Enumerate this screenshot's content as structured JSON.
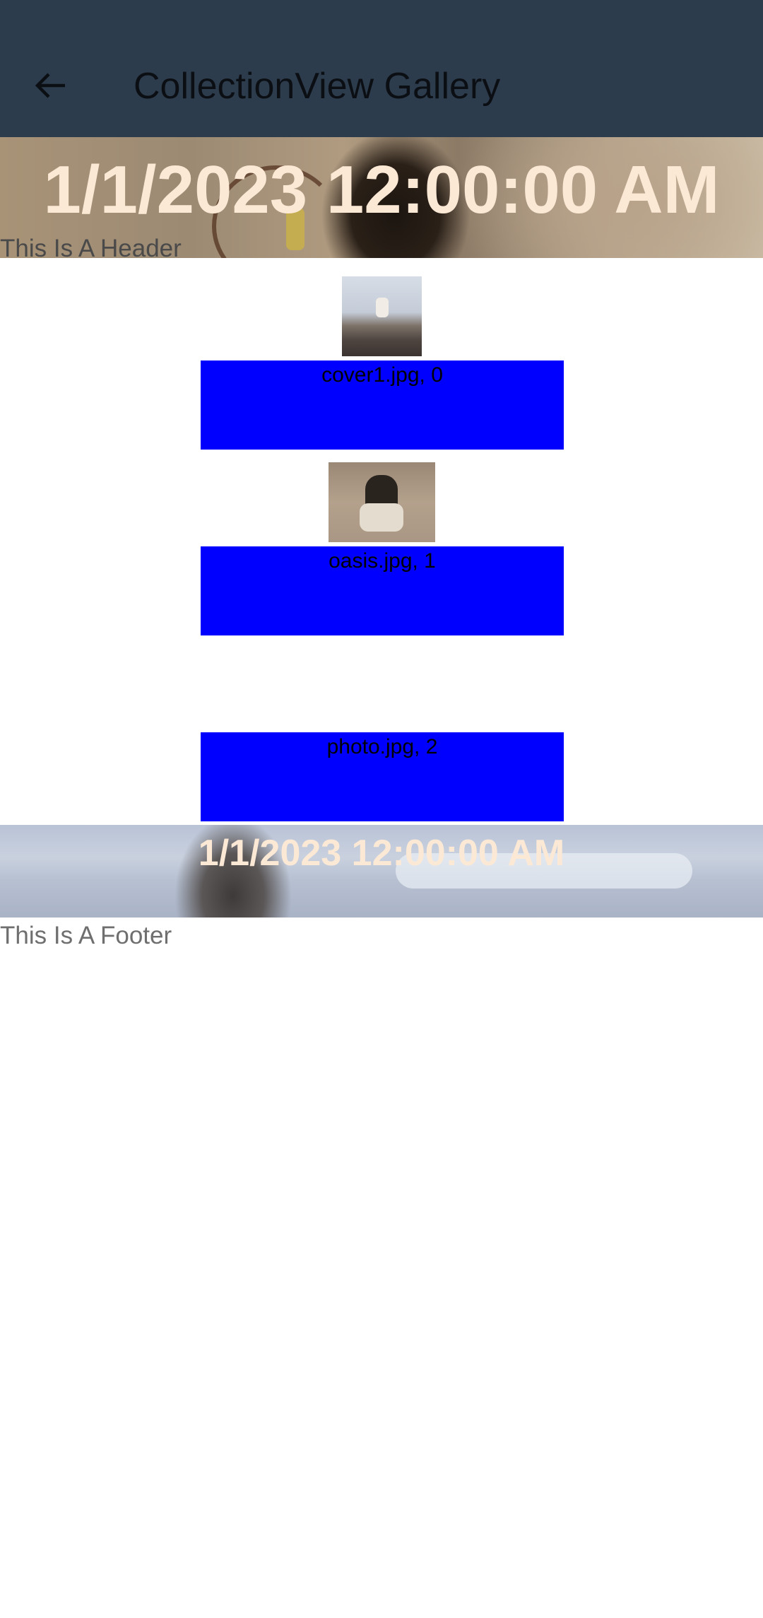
{
  "app_bar": {
    "title": "CollectionView Gallery",
    "back_icon": "arrow-left-icon",
    "background": "#2d3c4d"
  },
  "header": {
    "date": "1/1/2023 12:00:00 AM",
    "label": "This Is A Header",
    "date_color": "#fbe9d6"
  },
  "items": [
    {
      "caption": "cover1.jpg, 0",
      "image": "mountain-goat"
    },
    {
      "caption": "oasis.jpg, 1",
      "image": "pug-dog"
    },
    {
      "caption": "photo.jpg, 2",
      "image": ""
    }
  ],
  "item_box_color": "#0000ff",
  "footer": {
    "date": "1/1/2023 12:00:00 AM",
    "label": "This Is A Footer"
  }
}
